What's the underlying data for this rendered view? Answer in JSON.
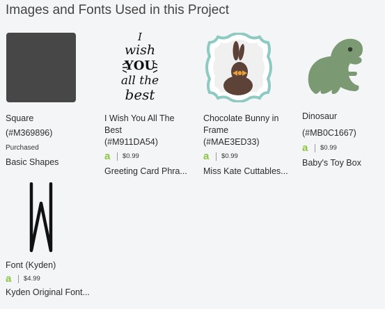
{
  "header": {
    "title": "Images and Fonts Used in this Project"
  },
  "items": [
    {
      "name": "Square",
      "code": "(#M369896)",
      "status": "Purchased",
      "category": "Basic Shapes",
      "icon": "square-image"
    },
    {
      "name": "I Wish You All The Best",
      "code": "(#M911DA54)",
      "access": "a",
      "price": "$0.99",
      "category": "Greeting Card Phra...",
      "icon": "lettering-image"
    },
    {
      "name": "Chocolate Bunny in Frame",
      "code": "(#MAE3ED33)",
      "access": "a",
      "price": "$0.99",
      "category": "Miss Kate Cuttables...",
      "icon": "bunny-image"
    },
    {
      "name": "Dinosaur",
      "code": "(#MB0C1667)",
      "access": "a",
      "price": "$0.99",
      "category": "Baby's Toy Box",
      "icon": "dinosaur-image"
    },
    {
      "name": "Font (Kyden)",
      "access": "a",
      "price": "$4.99",
      "category": "Kyden Original Font...",
      "icon": "font-w-image"
    }
  ],
  "lettering_art": [
    "I",
    "wish",
    "YOU",
    "all the",
    "best"
  ],
  "colors": {
    "square": "#474747",
    "access": "#8dc63f",
    "bunny": "#5d4337",
    "bow": "#e8a13a",
    "frame": "#8ec9c2",
    "dinosaur": "#7b9a73"
  }
}
